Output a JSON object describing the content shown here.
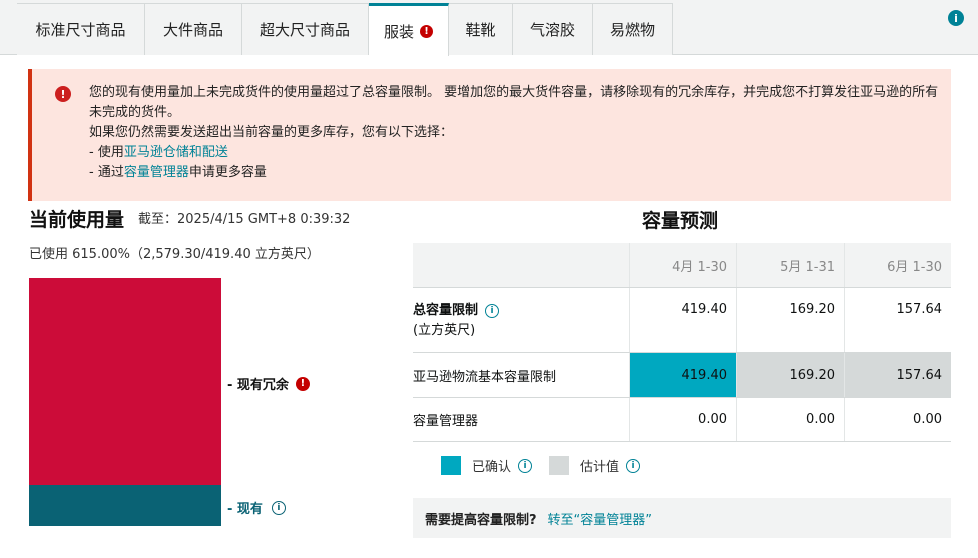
{
  "tabs": [
    {
      "label": "标准尺寸商品"
    },
    {
      "label": "大件商品"
    },
    {
      "label": "超大尺寸商品"
    },
    {
      "label": "服装",
      "alert": "!"
    },
    {
      "label": "鞋靴"
    },
    {
      "label": "气溶胶"
    },
    {
      "label": "易燃物"
    }
  ],
  "info_glyph": "i",
  "alert": {
    "icon": "!",
    "line1": "您的现有使用量加上未完成货件的使用量超过了总容量限制。 要增加您的最大货件容量，请移除现有的冗余库存，并完成您不打算发往亚马逊的所有未完成的货件。",
    "line2": "如果您仍然需要发送超出当前容量的更多库存，您有以下选择：",
    "opt1_prefix": "- 使用",
    "opt1_link": "亚马逊仓储和配送",
    "opt2_prefix": "- 通过",
    "opt2_link": "容量管理器",
    "opt2_suffix": "申请更多容量"
  },
  "usage": {
    "title": "当前使用量",
    "as_of": "截至：2025/4/15 GMT+8 0:39:32",
    "used_text": "已使用 615.00%（2,579.30/419.40 立方英尺）",
    "excess_label": "- 现有冗余",
    "excess_icon": "!",
    "current_label": "- 现有",
    "current_icon": "i"
  },
  "forecast": {
    "title": "容量预测",
    "months": [
      "4月 1-30",
      "5月 1-31",
      "6月 1-30"
    ],
    "total_label": "总容量限制",
    "total_unit": "(立方英尺)",
    "total_values": [
      "419.40",
      "169.20",
      "157.64"
    ],
    "base_label": "亚马逊物流基本容量限制",
    "base_values": [
      "419.40",
      "169.20",
      "157.64"
    ],
    "manager_label": "容量管理器",
    "manager_values": [
      "0.00",
      "0.00",
      "0.00"
    ],
    "legend_confirmed": "已确认",
    "legend_estimate": "估计值",
    "cta_text": "需要提高容量限制?",
    "cta_link": "转至“容量管理器”"
  },
  "colors": {
    "accent": "#008296",
    "excess": "#cc0c39",
    "current": "#0a6274",
    "confirmed": "#00a8c0",
    "estimate": "#d5d9d9"
  }
}
